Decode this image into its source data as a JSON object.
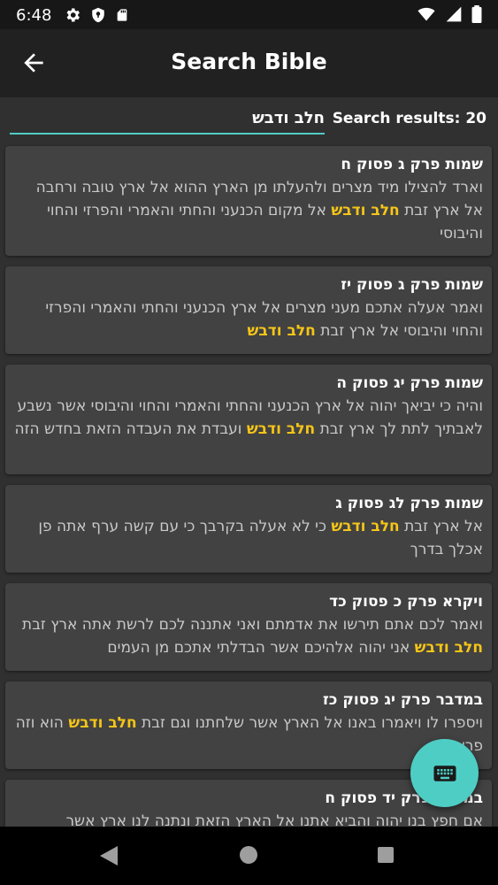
{
  "status_bar": {
    "time": "6:48",
    "left_icons": [
      "gear-icon",
      "shield-icon",
      "sd-card-icon"
    ],
    "right_icons": [
      "wifi-icon",
      "signal-icon",
      "battery-icon"
    ]
  },
  "app_bar": {
    "title": "Search Bible",
    "back_icon": "arrow-back-icon"
  },
  "search": {
    "query": "חלב ודבש",
    "results_label": "Search results: 20"
  },
  "colors": {
    "accent": "#4ecdc4",
    "highlight": "#f5c518",
    "card": "#424242",
    "background": "#303030"
  },
  "results": [
    {
      "title": "שמות פרק ג פסוק ח",
      "before": "וארד להצילו מיד מצרים ולהעלתו מן הארץ ההוא אל ארץ טובה ורחבה אל ארץ זבת ",
      "match": "חלב ודבש",
      "after": " אל מקום הכנעני והחתי והאמרי והפרזי והחוי והיבוסי"
    },
    {
      "title": "שמות פרק ג פסוק יז",
      "before": "ואמר אעלה אתכם מעני מצרים אל ארץ הכנעני והחתי והאמרי והפרזי והחוי והיבוסי אל ארץ זבת ",
      "match": "חלב ודבש",
      "after": ""
    },
    {
      "title": "שמות פרק יג פסוק ה",
      "before": "והיה כי יביאך יהוה אל ארץ הכנעני והחתי והאמרי והחוי והיבוסי אשר נשבע לאבתיך לתת לך ארץ זבת ",
      "match": "חלב ודבש",
      "after": " ועבדת את העבדה הזאת בחדש הזה"
    },
    {
      "title": "שמות פרק לג פסוק ג",
      "before": "אל ארץ זבת ",
      "match": "חלב ודבש",
      "after": " כי לא אעלה בקרבך כי עם קשה ערף אתה פן אכלך בדרך"
    },
    {
      "title": "ויקרא פרק כ פסוק כד",
      "before": "ואמר לכם אתם תירשו את אדמתם ואני אתננה לכם לרשת אתה ארץ זבת ",
      "match": "חלב ודבש",
      "after": " אני יהוה אלהיכם אשר הבדלתי אתכם מן העמים"
    },
    {
      "title": "במדבר פרק יג פסוק כז",
      "before": "ויספרו לו ויאמרו באנו אל הארץ אשר שלחתנו וגם זבת ",
      "match": "חלב ודבש",
      "after": " הוא וזה פריה"
    },
    {
      "title": "במדבר פרק יד פסוק ח",
      "before": "אם חפץ בנו יהוה והביא אתנו אל הארץ הזאת ונתנה לנו ארץ אשר",
      "match": "",
      "after": ""
    }
  ],
  "fab": {
    "icon": "keyboard-icon"
  },
  "nav_bar": {
    "icons": [
      "nav-back-icon",
      "nav-home-icon",
      "nav-recents-icon"
    ]
  }
}
